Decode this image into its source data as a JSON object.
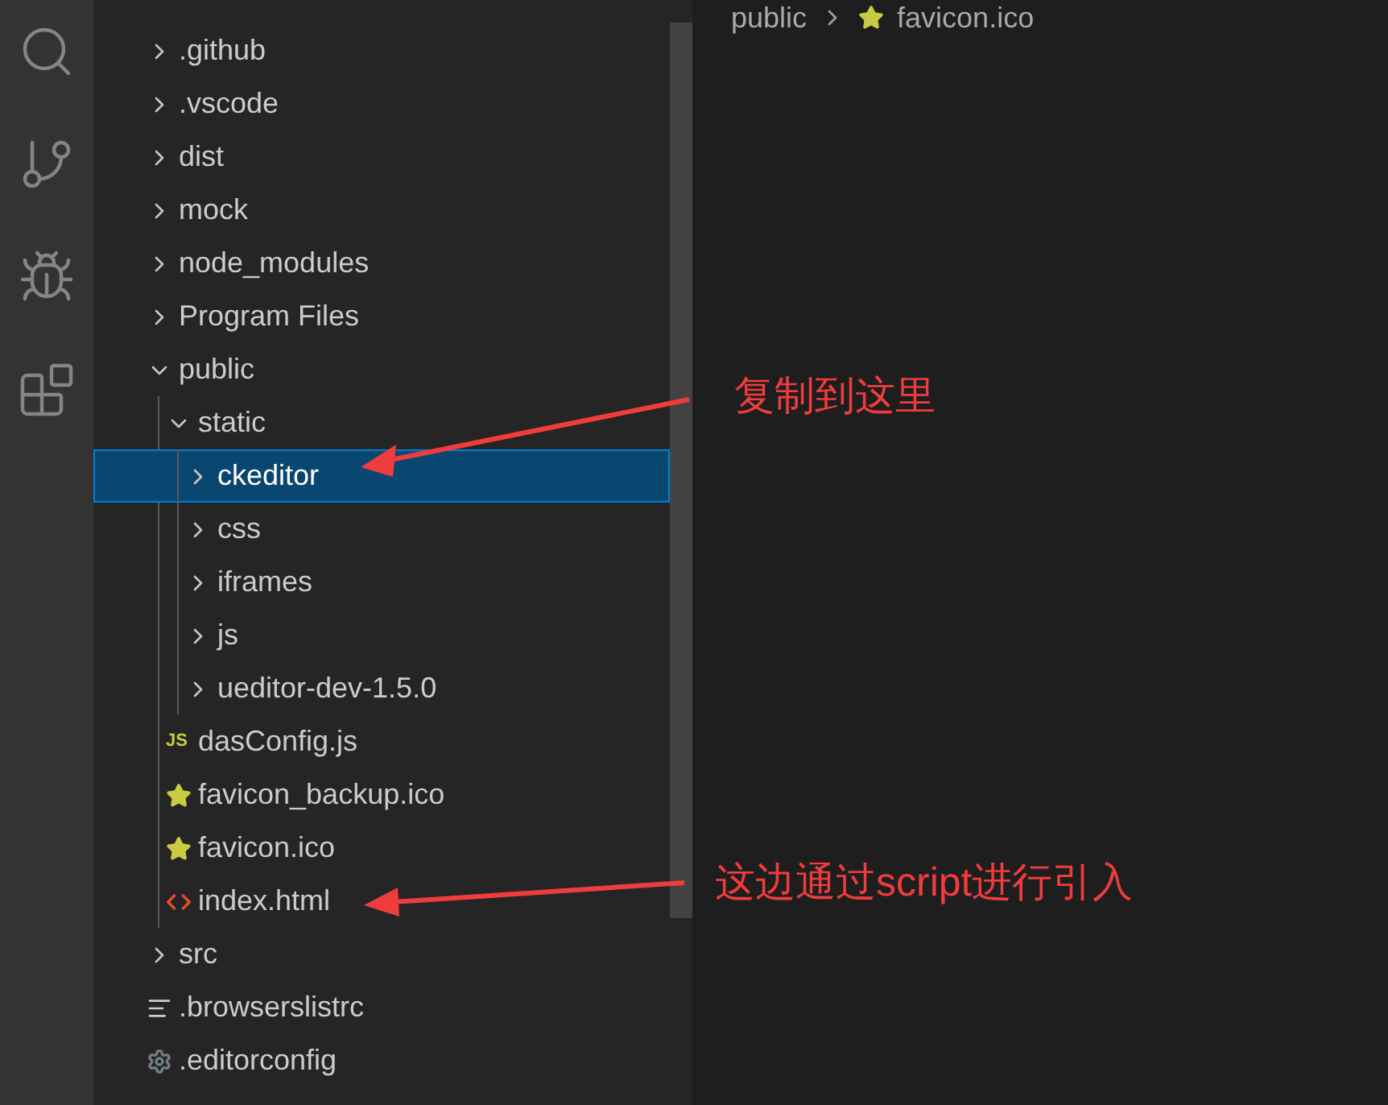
{
  "activity_bar": {
    "items": [
      {
        "kind": "search",
        "selected": false
      },
      {
        "kind": "source-control",
        "selected": false
      },
      {
        "kind": "run",
        "selected": false
      },
      {
        "kind": "extensions",
        "selected": false
      }
    ]
  },
  "breadcrumb": {
    "items": [
      {
        "label": "public",
        "kind": "folder"
      },
      {
        "label": "favicon.ico",
        "kind": "star"
      }
    ]
  },
  "explorer": {
    "tree": [
      {
        "label": ".github",
        "kind": "folder",
        "expanded": false,
        "selected": false
      },
      {
        "label": ".vscode",
        "kind": "folder",
        "expanded": false,
        "selected": false
      },
      {
        "label": "dist",
        "kind": "folder",
        "expanded": false,
        "selected": false
      },
      {
        "label": "mock",
        "kind": "folder",
        "expanded": false,
        "selected": false
      },
      {
        "label": "node_modules",
        "kind": "folder",
        "expanded": false,
        "selected": false
      },
      {
        "label": "Program Files",
        "kind": "folder",
        "expanded": false,
        "selected": false
      },
      {
        "label": "public",
        "kind": "folder",
        "expanded": true,
        "selected": false,
        "children": [
          {
            "label": "static",
            "kind": "folder",
            "expanded": true,
            "selected": false,
            "children": [
              {
                "label": "ckeditor",
                "kind": "folder",
                "expanded": false,
                "selected": true
              },
              {
                "label": "css",
                "kind": "folder",
                "expanded": false,
                "selected": false
              },
              {
                "label": "iframes",
                "kind": "folder",
                "expanded": false,
                "selected": false
              },
              {
                "label": "js",
                "kind": "folder",
                "expanded": false,
                "selected": false
              },
              {
                "label": "ueditor-dev-1.5.0",
                "kind": "folder",
                "expanded": false,
                "selected": false
              }
            ]
          },
          {
            "label": "dasConfig.js",
            "kind": "js",
            "icon_text": "JS",
            "selected": false
          },
          {
            "label": "favicon_backup.ico",
            "kind": "star",
            "selected": false
          },
          {
            "label": "favicon.ico",
            "kind": "star",
            "selected": false
          },
          {
            "label": "index.html",
            "kind": "html",
            "selected": false
          }
        ]
      },
      {
        "label": "src",
        "kind": "folder",
        "expanded": false,
        "selected": false
      },
      {
        "label": ".browserslistrc",
        "kind": "text",
        "selected": false
      },
      {
        "label": ".editorconfig",
        "kind": "config",
        "selected": false
      }
    ]
  },
  "annotations": [
    {
      "text": "复制到这里"
    },
    {
      "text": "这边通过script进行引入"
    }
  ]
}
